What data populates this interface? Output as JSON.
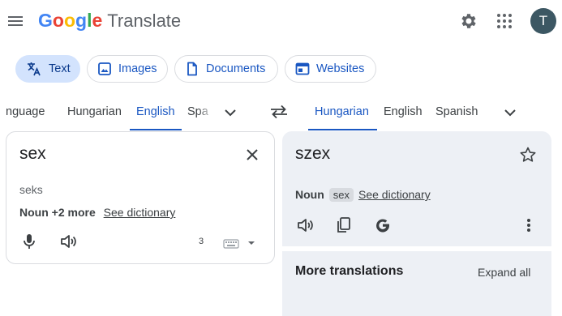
{
  "header": {
    "logo_letters": [
      {
        "ch": "G",
        "color": "#4285F4"
      },
      {
        "ch": "o",
        "color": "#EA4335"
      },
      {
        "ch": "o",
        "color": "#FBBC05"
      },
      {
        "ch": "g",
        "color": "#4285F4"
      },
      {
        "ch": "l",
        "color": "#34A853"
      },
      {
        "ch": "e",
        "color": "#EA4335"
      }
    ],
    "product": "Translate",
    "avatar_initial": "T"
  },
  "modes": [
    {
      "label": "Text",
      "icon": "translate-icon",
      "active": true
    },
    {
      "label": "Images",
      "icon": "image-icon",
      "active": false
    },
    {
      "label": "Documents",
      "icon": "document-icon",
      "active": false
    },
    {
      "label": "Websites",
      "icon": "website-icon",
      "active": false
    }
  ],
  "source_langs": [
    "nguage",
    "Hungarian",
    "English",
    "Spa"
  ],
  "target_langs": [
    "Hungarian",
    "English",
    "Spanish"
  ],
  "source": {
    "text": "sex",
    "transliteration": "seks",
    "pos_summary": "Noun +2 more",
    "dictionary_link": "See dictionary",
    "char_count": "3"
  },
  "target": {
    "text": "szex",
    "pos": "Noun",
    "chip": "sex",
    "dictionary_link": "See dictionary"
  },
  "more_translations": {
    "title": "More translations",
    "expand": "Expand all"
  },
  "colors": {
    "accent": "#1a57c2",
    "active_mode_bg": "#d3e3fd",
    "target_panel_bg": "#edf0f5"
  }
}
